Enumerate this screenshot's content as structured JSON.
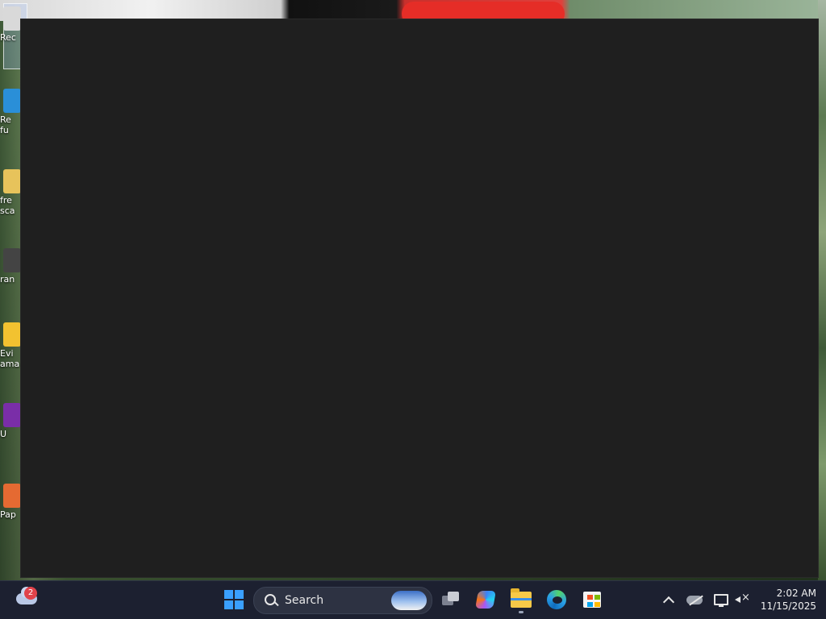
{
  "desktop": {
    "icons": [
      {
        "label": "Rec",
        "color": "#d9d9d9"
      },
      {
        "label": "Re\nfu",
        "color": "#2a8fd8"
      },
      {
        "label": "fre\nsca",
        "color": "#e7c35b"
      },
      {
        "label": "ran",
        "color": "#444444"
      },
      {
        "label": "Evi\nama",
        "color": "#f2c230"
      },
      {
        "label": "U",
        "color": "#7a2ea8"
      },
      {
        "label": "Pap",
        "color": "#e56a32"
      }
    ]
  },
  "taskbar": {
    "weather": {
      "badge_count": "2"
    },
    "search": {
      "label": "Search"
    },
    "pinned": [
      {
        "name": "start-button"
      },
      {
        "name": "task-view-button"
      },
      {
        "name": "copilot-button"
      },
      {
        "name": "file-explorer-button",
        "active": true
      },
      {
        "name": "edge-button"
      },
      {
        "name": "store-button"
      }
    ],
    "clock": {
      "time": "2:02 AM",
      "date": "11/15/2025"
    }
  },
  "colors": {
    "window_bg": "#1f1f1f",
    "taskbar_bg": "#1c2030",
    "accent": "#3aa0ff"
  }
}
